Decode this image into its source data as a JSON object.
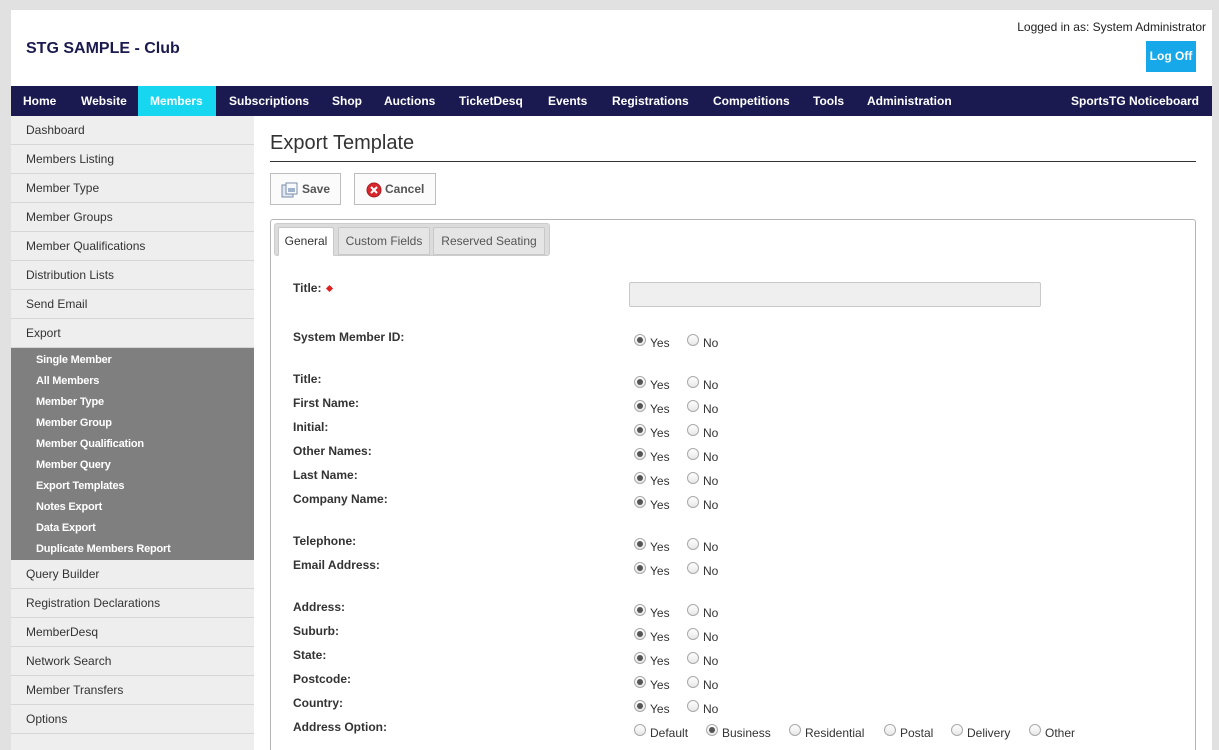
{
  "header": {
    "site_title": "STG SAMPLE - Club",
    "login_text": "Logged in as: System Administrator",
    "logoff_label": "Log Off"
  },
  "nav": {
    "items": [
      "Home",
      "Website",
      "Members",
      "Subscriptions",
      "Shop",
      "Auctions",
      "TicketDesq",
      "Events",
      "Registrations",
      "Competitions",
      "Tools",
      "Administration"
    ],
    "active": "Members",
    "right_item": "SportsTG Noticeboard",
    "bar_color": "#1a1a50",
    "active_color": "#16d6f0"
  },
  "sidebar": {
    "items_top": [
      "Dashboard",
      "Members Listing",
      "Member Type",
      "Member Groups",
      "Member Qualifications",
      "Distribution Lists",
      "Send Email",
      "Export"
    ],
    "submenu": [
      "Single Member",
      "All Members",
      "Member Type",
      "Member Group",
      "Member Qualification",
      "Member Query",
      "Export Templates",
      "Notes Export",
      "Data Export",
      "Duplicate Members Report"
    ],
    "items_bottom": [
      "Query Builder",
      "Registration Declarations",
      "MemberDesq",
      "Network Search",
      "Member Transfers",
      "Options"
    ]
  },
  "main": {
    "heading": "Export Template",
    "save_label": "Save",
    "cancel_label": "Cancel",
    "tabs": [
      "General",
      "Custom Fields",
      "Reserved Seating"
    ],
    "active_tab": "General"
  },
  "form": {
    "title_label": "Title:",
    "title_value": "",
    "yes_label": "Yes",
    "no_label": "No",
    "fields": [
      {
        "label": "System Member ID:",
        "value": "Yes"
      },
      {
        "label": "Title:",
        "value": "Yes"
      },
      {
        "label": "First Name:",
        "value": "Yes"
      },
      {
        "label": "Initial:",
        "value": "Yes"
      },
      {
        "label": "Other Names:",
        "value": "Yes"
      },
      {
        "label": "Last Name:",
        "value": "Yes"
      },
      {
        "label": "Company Name:",
        "value": "Yes"
      },
      {
        "label": "Telephone:",
        "value": "Yes"
      },
      {
        "label": "Email Address:",
        "value": "Yes"
      },
      {
        "label": "Address:",
        "value": "Yes"
      },
      {
        "label": "Suburb:",
        "value": "Yes"
      },
      {
        "label": "State:",
        "value": "Yes"
      },
      {
        "label": "Postcode:",
        "value": "Yes"
      },
      {
        "label": "Country:",
        "value": "Yes"
      }
    ],
    "address_option": {
      "label": "Address Option:",
      "options": [
        "Default",
        "Business",
        "Residential",
        "Postal",
        "Delivery",
        "Other"
      ],
      "selected": "Business"
    }
  }
}
